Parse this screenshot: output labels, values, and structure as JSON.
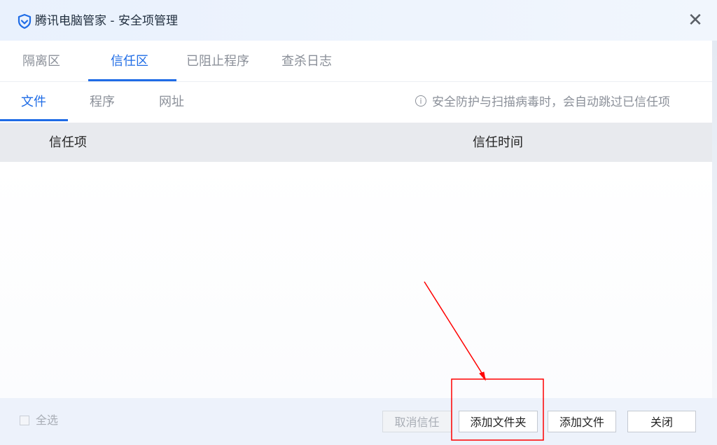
{
  "window": {
    "title": "腾讯电脑管家 - 安全项管理",
    "close_glyph": "✕"
  },
  "main_tabs": [
    {
      "label": "隔离区",
      "active": false
    },
    {
      "label": "信任区",
      "active": true
    },
    {
      "label": "已阻止程序",
      "active": false
    },
    {
      "label": "查杀日志",
      "active": false
    }
  ],
  "sub_tabs": [
    {
      "label": "文件",
      "active": true
    },
    {
      "label": "程序",
      "active": false
    },
    {
      "label": "网址",
      "active": false
    }
  ],
  "info_hint": {
    "icon": "i",
    "text": "安全防护与扫描病毒时，会自动跳过已信任项"
  },
  "table": {
    "columns": [
      "信任项",
      "信任时间"
    ],
    "rows": []
  },
  "footer": {
    "select_all_label": "全选",
    "select_all_checked": false,
    "buttons": {
      "untrust": "取消信任",
      "add_folder": "添加文件夹",
      "add_file": "添加文件",
      "close": "关闭"
    }
  },
  "colors": {
    "accent": "#1f6ce6",
    "annotation": "#ff0000"
  }
}
